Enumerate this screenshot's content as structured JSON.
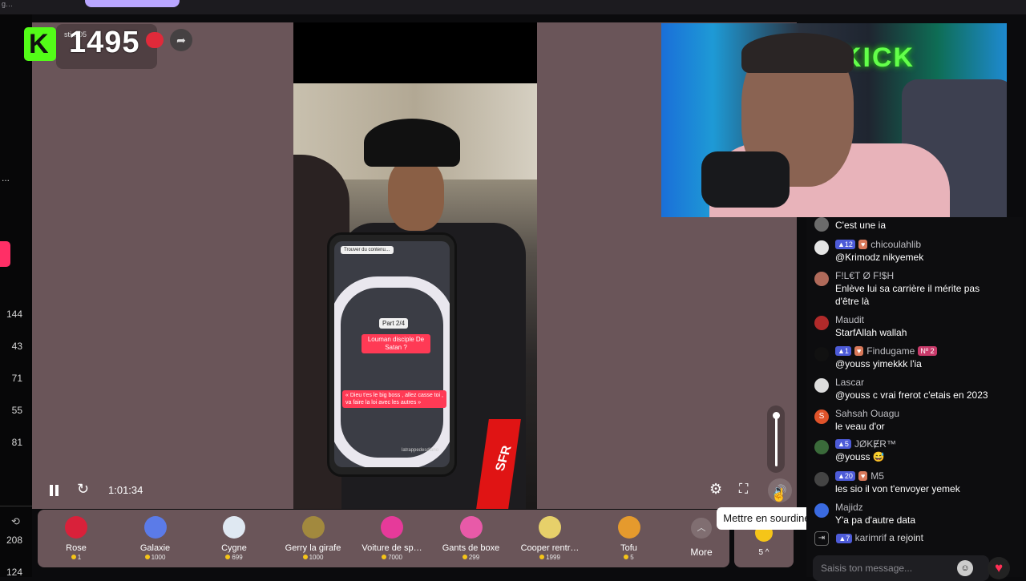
{
  "topbar": {
    "crumb": "g…"
  },
  "left_column": {
    "counts": [
      "144",
      "43",
      "71",
      "55",
      "81",
      "208",
      "124"
    ],
    "dots": "..."
  },
  "stream": {
    "viewer_count": "1495",
    "overlay_text": "sti…05",
    "elapsed": "1:01:34",
    "video_tags": {
      "search": "Trouver du contenu…",
      "part": "Part 2/4",
      "caption_top": "Louman disciple De Satan ?",
      "caption_bottom": "« Dieu t'es le big boss , allez casse toi , va faire la loi avec les autres »",
      "channel": "latrappedesdiano",
      "tv": "SFR"
    },
    "webcam_banner": "KICK",
    "tooltip": "Mettre en sourdine (M)"
  },
  "gifts": [
    {
      "name": "Rose",
      "price": "1",
      "color": "#d9213a"
    },
    {
      "name": "Galaxie",
      "price": "1000",
      "color": "#5b7be8"
    },
    {
      "name": "Cygne",
      "price": "699",
      "color": "#dfe8f2"
    },
    {
      "name": "Gerry la girafe",
      "price": "1000",
      "color": "#a2893e"
    },
    {
      "name": "Voiture de sp…",
      "price": "7000",
      "color": "#e63a9a"
    },
    {
      "name": "Gants de boxe",
      "price": "299",
      "color": "#e85aa8"
    },
    {
      "name": "Cooper rentr…",
      "price": "1999",
      "color": "#e7d06a"
    },
    {
      "name": "Tofu",
      "price": "5",
      "color": "#e59a2d"
    }
  ],
  "gifts_more": "More",
  "gifts_extra": "5 ^",
  "chat": {
    "messages": [
      {
        "user": "",
        "badges": [],
        "text": "C'est une ia",
        "avatar": "#6b6b6b"
      },
      {
        "user": "chicoulahlib",
        "badges": [
          {
            "t": "12",
            "c": ""
          },
          {
            "t": "♥",
            "c": "or"
          }
        ],
        "text": "@Krimodz nikyemek",
        "avatar": "#e5e5e5"
      },
      {
        "user": "F!L€T Ø F!$H",
        "badges": [],
        "text": "Enlève lui sa carrière il mérite pas d'être là",
        "avatar": "#b06a5a"
      },
      {
        "user": "Maudit",
        "badges": [],
        "text": "StarfAllah wallah",
        "avatar": "#b02a2a"
      },
      {
        "user": "Findugame",
        "badges": [
          {
            "t": "1",
            "c": ""
          },
          {
            "t": "♥",
            "c": "or"
          }
        ],
        "extra": "Nº 2",
        "text": "@youss yimekkk l'ia",
        "avatar": "#111111"
      },
      {
        "user": "Lascar",
        "badges": [],
        "text": "@youss c vrai frerot c'etais en 2023",
        "avatar": "#dddddd"
      },
      {
        "user": "Sahsah Ouagu",
        "badges": [],
        "text": "le veau d'or",
        "avatar": "#e0532a",
        "initial": "S"
      },
      {
        "user": "JØKɆR™",
        "badges": [
          {
            "t": "5",
            "c": ""
          }
        ],
        "text": "@youss 😅",
        "avatar": "#3a6a3a"
      },
      {
        "user": "M5",
        "badges": [
          {
            "t": "20",
            "c": ""
          },
          {
            "t": "♥",
            "c": "or"
          }
        ],
        "text": "les sio il von t'envoyer yemek",
        "avatar": "#444"
      },
      {
        "user": "Majidz",
        "badges": [],
        "text": "Y'a pa d'autre data",
        "avatar": "#3a6ae0"
      }
    ],
    "joined_user": "karimrif",
    "joined_badge": "7",
    "joined_text": "a rejoint",
    "input_placeholder": "Saisis ton message..."
  }
}
